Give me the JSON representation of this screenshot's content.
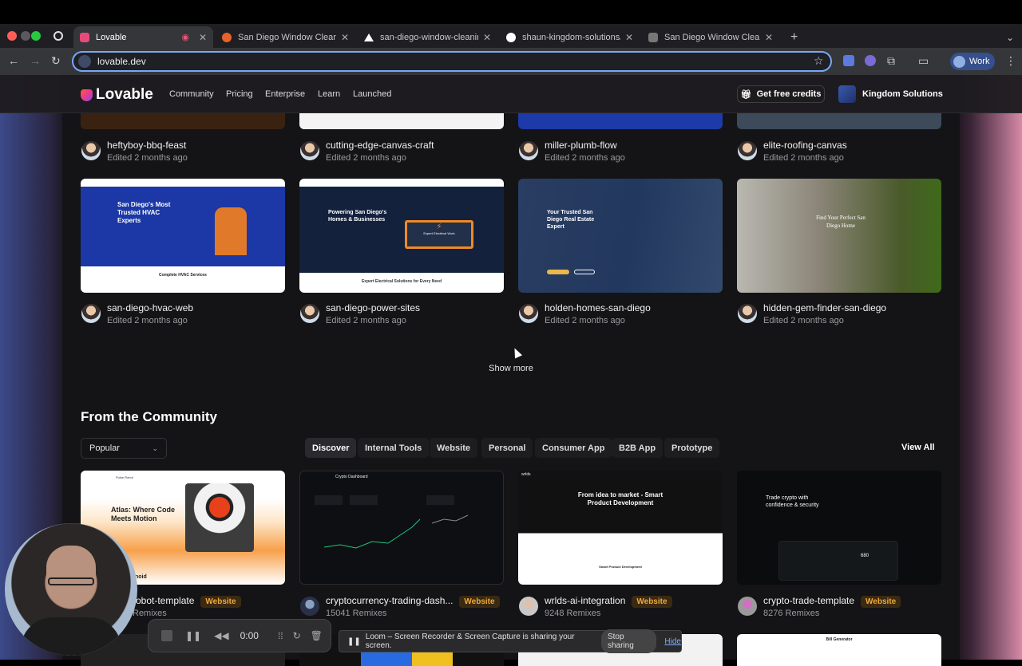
{
  "browser": {
    "tabs": [
      {
        "title": "Lovable",
        "active": true,
        "color": "#e84a7a"
      },
      {
        "title": "San Diego Window Cleaning",
        "active": false,
        "color": "#e8632a"
      },
      {
        "title": "san-diego-window-cleaning-",
        "active": false,
        "color": "#ffffff"
      },
      {
        "title": "shaun-kingdom-solutions/sa",
        "active": false,
        "color": "#ffffff"
      },
      {
        "title": "San Diego Window Cleaning",
        "active": false,
        "color": "#888888"
      }
    ],
    "url": "lovable.dev",
    "profile_label": "Work"
  },
  "header": {
    "brand": "Lovable",
    "nav": [
      "Community",
      "Pricing",
      "Enterprise",
      "Learn",
      "Launched"
    ],
    "credits_label": "Get free credits",
    "workspace": "Kingdom Solutions"
  },
  "projects": [
    {
      "name": "heftyboy-bbq-feast",
      "edited": "Edited 2 months ago"
    },
    {
      "name": "cutting-edge-canvas-craft",
      "edited": "Edited 2 months ago"
    },
    {
      "name": "miller-plumb-flow",
      "edited": "Edited 2 months ago"
    },
    {
      "name": "elite-roofing-canvas",
      "edited": "Edited 2 months ago"
    },
    {
      "name": "san-diego-hvac-web",
      "edited": "Edited 2 months ago",
      "thumb": {
        "headline": "San Diego's Most Trusted HVAC Experts",
        "footer": "Complete HVAC Services"
      }
    },
    {
      "name": "san-diego-power-sites",
      "edited": "Edited 2 months ago",
      "thumb": {
        "headline": "Powering San Diego's Homes & Businesses",
        "card": "Expert Electrical Work",
        "footer": "Expert Electrical Solutions for Every Need"
      }
    },
    {
      "name": "holden-homes-san-diego",
      "edited": "Edited 2 months ago",
      "thumb": {
        "headline": "Your Trusted San Diego Real Estate Expert"
      }
    },
    {
      "name": "hidden-gem-finder-san-diego",
      "edited": "Edited 2 months ago",
      "thumb": {
        "headline": "Find Your Perfect San Diego Home"
      }
    }
  ],
  "show_more": "Show more",
  "community": {
    "title": "From the Community",
    "sort": "Popular",
    "filters": [
      "Discover",
      "Internal Tools",
      "Website",
      "Personal",
      "Consumer App",
      "B2B App",
      "Prototype"
    ],
    "view_all": "View All",
    "items": [
      {
        "name": "obot-template",
        "badge": "Website",
        "remixes": "Remixes",
        "thumb": {
          "headline": "Atlas: Where Code Meets Motion",
          "brand": "Pulse Robot",
          "extra": "noid"
        }
      },
      {
        "name": "cryptocurrency-trading-dash...",
        "badge": "Website",
        "remixes": "15041 Remixes",
        "thumb": {
          "headline": "Crypto Dashboard"
        }
      },
      {
        "name": "wrlds-ai-integration",
        "badge": "Website",
        "remixes": "9248 Remixes",
        "thumb": {
          "brand": "wrlds",
          "headline": "From idea to market - Smart Product Development",
          "sub": "Smart Product Development"
        }
      },
      {
        "name": "crypto-trade-template",
        "badge": "Website",
        "remixes": "8276 Remixes",
        "thumb": {
          "headline": "Trade crypto with confidence & security",
          "stat": "680"
        }
      }
    ],
    "bottom_thumb_label": "Bill Generator"
  },
  "loom": {
    "timer": "0:00",
    "message": "Loom – Screen Recorder & Screen Capture is sharing your screen.",
    "stop_label": "Stop sharing",
    "hide_label": "Hide"
  }
}
